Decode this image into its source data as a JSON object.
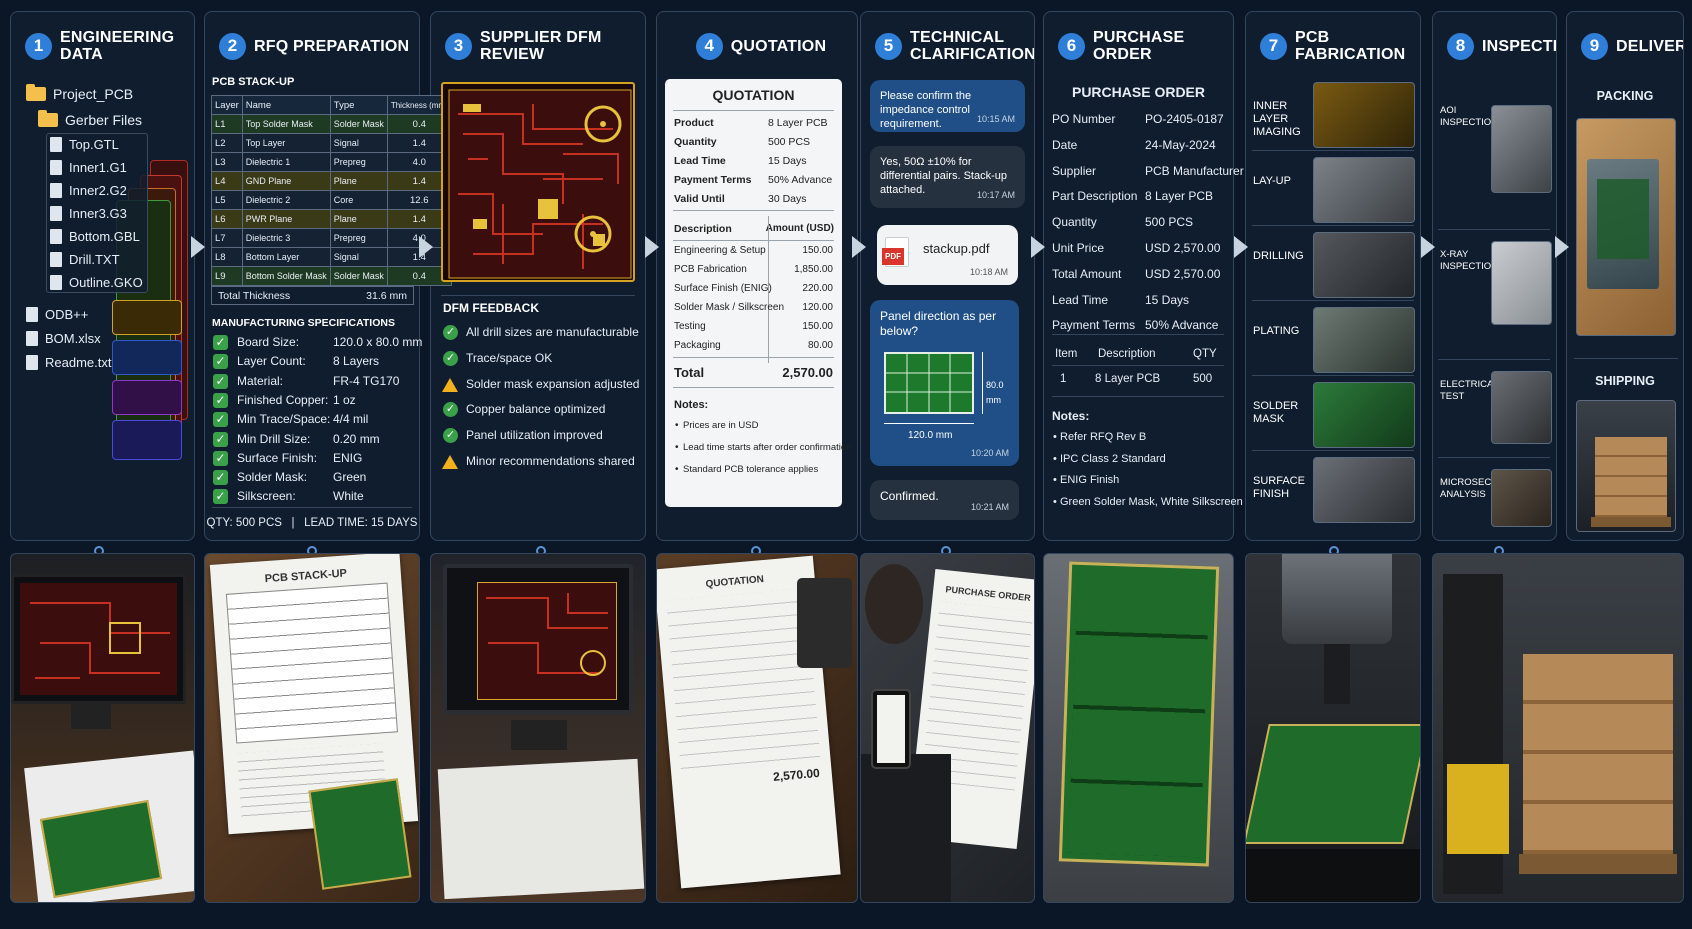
{
  "steps": [
    {
      "num": "1",
      "title": "ENGINEERING DATA"
    },
    {
      "num": "2",
      "title": "RFQ PREPARATION"
    },
    {
      "num": "3",
      "title": "SUPPLIER DFM REVIEW"
    },
    {
      "num": "4",
      "title": "QUOTATION"
    },
    {
      "num": "5",
      "title": "TECHNICAL CLARIFICATION"
    },
    {
      "num": "6",
      "title": "PURCHASE ORDER"
    },
    {
      "num": "7",
      "title": "PCB FABRICATION"
    },
    {
      "num": "8",
      "title": "INSPECTION"
    },
    {
      "num": "9",
      "title": "DELIVERY"
    }
  ],
  "engineering": {
    "project_folder": "Project_PCB",
    "gerber_folder": "Gerber Files",
    "gerber_files": [
      "Top.GTL",
      "Inner1.G1",
      "Inner2.G2",
      "Inner3.G3",
      "Bottom.GBL",
      "Drill.TXT",
      "Outline.GKO"
    ],
    "other_files": [
      "ODB++",
      "BOM.xlsx",
      "Readme.txt"
    ]
  },
  "rfq": {
    "stackup_title": "PCB STACK-UP",
    "columns": [
      "Layer",
      "Name",
      "Type",
      "Thickness (mm)"
    ],
    "rows": [
      [
        "L1",
        "Top Solder Mask",
        "Solder Mask",
        "0.4"
      ],
      [
        "L2",
        "Top Layer",
        "Signal",
        "1.4"
      ],
      [
        "L3",
        "Dielectric 1",
        "Prepreg",
        "4.0"
      ],
      [
        "L4",
        "GND Plane",
        "Plane",
        "1.4"
      ],
      [
        "L5",
        "Dielectric 2",
        "Core",
        "12.6"
      ],
      [
        "L6",
        "PWR Plane",
        "Plane",
        "1.4"
      ],
      [
        "L7",
        "Dielectric 3",
        "Prepreg",
        "4.0"
      ],
      [
        "L8",
        "Bottom Layer",
        "Signal",
        "1.4"
      ],
      [
        "L9",
        "Bottom Solder Mask",
        "Solder Mask",
        "0.4"
      ]
    ],
    "total_label": "Total Thickness",
    "total_value": "31.6 mm",
    "specs_title": "MANUFACTURING SPECIFICATIONS",
    "specs": [
      [
        "Board Size:",
        "120.0 x 80.0 mm"
      ],
      [
        "Layer Count:",
        "8 Layers"
      ],
      [
        "Material:",
        "FR-4 TG170"
      ],
      [
        "Finished Copper:",
        "1 oz"
      ],
      [
        "Min Trace/Space:",
        "4/4 mil"
      ],
      [
        "Min Drill Size:",
        "0.20 mm"
      ],
      [
        "Surface Finish:",
        "ENIG"
      ],
      [
        "Solder Mask:",
        "Green"
      ],
      [
        "Silkscreen:",
        "White"
      ]
    ],
    "footer": "QTY: 500 PCS   |   LEAD TIME: 15 DAYS"
  },
  "dfm": {
    "title": "DFM FEEDBACK",
    "items": [
      {
        "text": "All drill sizes are manufacturable",
        "status": "ok"
      },
      {
        "text": "Trace/space OK",
        "status": "ok"
      },
      {
        "text": "Solder mask expansion adjusted",
        "status": "warn"
      },
      {
        "text": "Copper balance optimized",
        "status": "ok"
      },
      {
        "text": "Panel utilization improved",
        "status": "ok"
      },
      {
        "text": "Minor recommendations shared",
        "status": "warn"
      }
    ]
  },
  "quotation": {
    "title": "QUOTATION",
    "fields": [
      [
        "Product",
        "8 Layer PCB"
      ],
      [
        "Quantity",
        "500 PCS"
      ],
      [
        "Lead Time",
        "15 Days"
      ],
      [
        "Payment Terms",
        "50% Advance"
      ],
      [
        "Valid Until",
        "30 Days"
      ]
    ],
    "col_desc": "Description",
    "col_amt": "Amount (USD)",
    "lines": [
      [
        "Engineering & Setup",
        "150.00"
      ],
      [
        "PCB Fabrication",
        "1,850.00"
      ],
      [
        "Surface Finish (ENIG)",
        "220.00"
      ],
      [
        "Solder Mask / Silkscreen",
        "120.00"
      ],
      [
        "Testing",
        "150.00"
      ],
      [
        "Packaging",
        "80.00"
      ]
    ],
    "total_label": "Total",
    "total_value": "2,570.00",
    "notes_title": "Notes:",
    "notes": [
      "Prices are in USD",
      "Lead time starts after order confirmation",
      "Standard PCB tolerance applies"
    ]
  },
  "chat": {
    "m1": "Please confirm the impedance control requirement.",
    "t1": "10:15 AM",
    "m2": "Yes, 50Ω ±10% for differential pairs. Stack-up attached.",
    "t2": "10:17 AM",
    "file": "stackup.pdf",
    "pdf_badge": "PDF",
    "t3": "10:18 AM",
    "m4": "Panel direction as per below?",
    "dim_w": "120.0 mm",
    "dim_h": "80.0 mm",
    "t4": "10:20 AM",
    "m5": "Confirmed.",
    "t5": "10:21 AM"
  },
  "po": {
    "title": "PURCHASE ORDER",
    "fields": [
      [
        "PO Number",
        "PO-2405-0187"
      ],
      [
        "Date",
        "24-May-2024"
      ],
      [
        "Supplier",
        "PCB Manufacturer"
      ],
      [
        "Part Description",
        "8 Layer PCB"
      ],
      [
        "Quantity",
        "500 PCS"
      ],
      [
        "Unit Price",
        "USD 2,570.00"
      ],
      [
        "Total Amount",
        "USD 2,570.00"
      ],
      [
        "Lead Time",
        "15 Days"
      ],
      [
        "Payment Terms",
        "50% Advance"
      ]
    ],
    "cols": [
      "Item",
      "Description",
      "QTY"
    ],
    "row": [
      "1",
      "8 Layer PCB",
      "500"
    ],
    "notes_title": "Notes:",
    "notes": [
      "Refer RFQ Rev B",
      "IPC Class 2 Standard",
      "ENIG Finish",
      "Green Solder Mask, White Silkscreen"
    ]
  },
  "fab": {
    "steps": [
      "INNER LAYER IMAGING",
      "LAY-UP",
      "DRILLING",
      "PLATING",
      "SOLDER MASK",
      "SURFACE FINISH"
    ]
  },
  "inspection": {
    "steps": [
      "AOI INSPECTION",
      "X-RAY INSPECTION",
      "ELECTRICAL TEST",
      "MICROSECTION ANALYSIS"
    ]
  },
  "delivery": {
    "packing": "PACKING",
    "shipping": "SHIPPING"
  },
  "photos": {
    "stackup_title": "PCB STACK-UP",
    "quotation_title": "QUOTATION",
    "quotation_total": "2,570.00",
    "po_title": "PURCHASE ORDER"
  },
  "colors": {
    "accent": "#2f7fd9",
    "panel": "#101d2e",
    "ok": "#3aa04a",
    "warn": "#f2b01e",
    "bubble": "#1f4f86"
  }
}
